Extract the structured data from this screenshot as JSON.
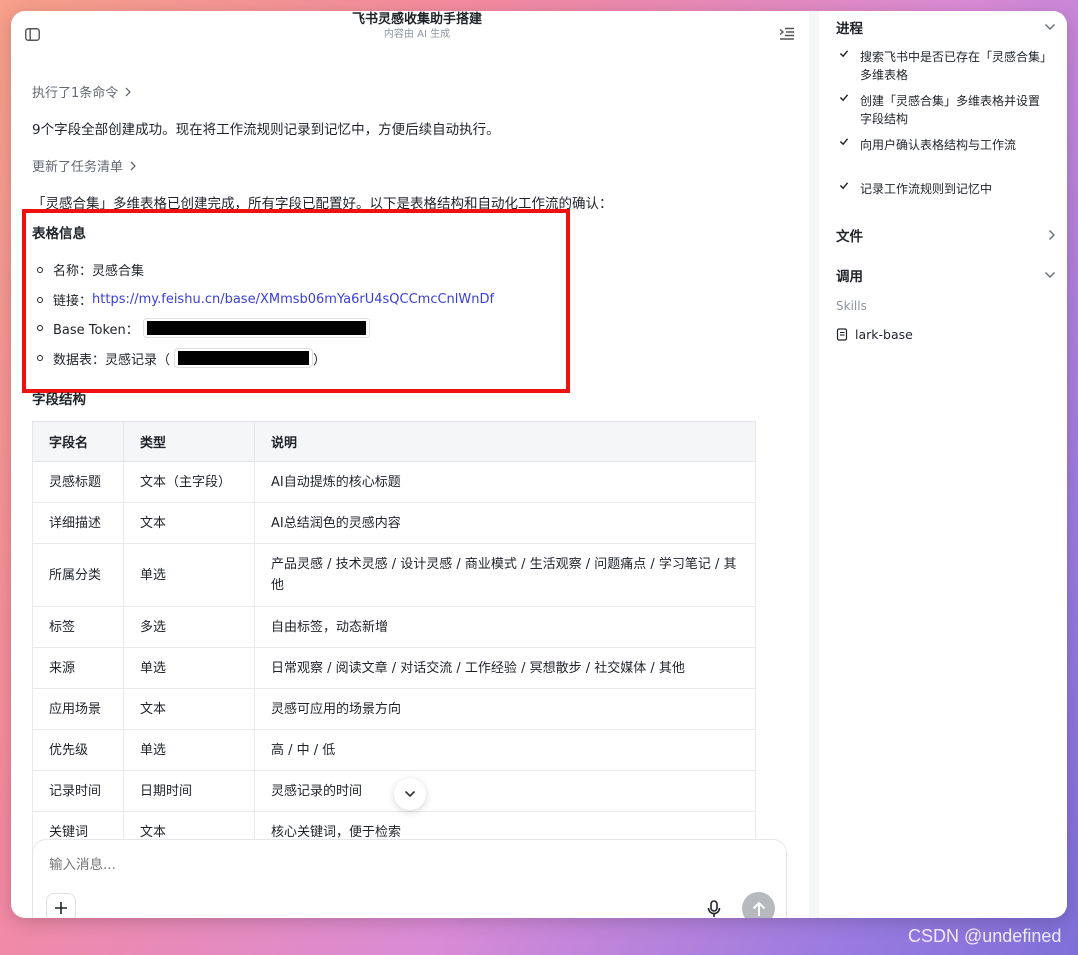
{
  "header": {
    "title": "飞书灵感收集助手搭建",
    "subtitle": "内容由 AI 生成"
  },
  "chat": {
    "step1": "执行了1条命令",
    "msg1": "9个字段全部创建成功。现在将工作流规则记录到记忆中，方便后续自动执行。",
    "step2": "更新了任务清单",
    "msg2": "「灵感合集」多维表格已创建完成，所有字段已配置好。以下是表格结构和自动化工作流的确认：",
    "table_info_heading": "表格信息",
    "info": {
      "name_label": "名称：",
      "name_value": "灵感合集",
      "link_label": "链接：",
      "link_value": "https://my.feishu.cn/base/XMmsb06mYa6rU4sQCCmcCnlWnDf",
      "token_label": "Base Token：",
      "datatable_label": "数据表：",
      "datatable_value": "灵感记录（",
      "datatable_close": "）"
    },
    "fields_heading": "字段结构"
  },
  "fields_table": {
    "headers": [
      "字段名",
      "类型",
      "说明"
    ],
    "rows": [
      [
        "灵感标题",
        "文本（主字段）",
        "AI自动提炼的核心标题"
      ],
      [
        "详细描述",
        "文本",
        "AI总结润色的灵感内容"
      ],
      [
        "所属分类",
        "单选",
        "产品灵感 / 技术灵感 / 设计灵感 / 商业模式 / 生活观察 / 问题痛点 / 学习笔记 / 其他"
      ],
      [
        "标签",
        "多选",
        "自由标签，动态新增"
      ],
      [
        "来源",
        "单选",
        "日常观察 / 阅读文章 / 对话交流 / 工作经验 / 冥想散步 / 社交媒体 / 其他"
      ],
      [
        "应用场景",
        "文本",
        "灵感可应用的场景方向"
      ],
      [
        "优先级",
        "单选",
        "高 / 中 / 低"
      ],
      [
        "记录时间",
        "日期时间",
        "灵感记录的时间"
      ],
      [
        "关键词",
        "文本",
        "核心关键词，便于检索"
      ]
    ]
  },
  "composer": {
    "placeholder": "输入消息..."
  },
  "sidebar": {
    "progress_title": "进程",
    "progress_items": [
      "搜索飞书中是否已存在「灵感合集」多维表格",
      "创建「灵感合集」多维表格并设置字段结构",
      "向用户确认表格结构与工作流",
      "记录工作流规则到记忆中"
    ],
    "files_title": "文件",
    "calls_title": "调用",
    "skills_label": "Skills",
    "skill_name": "lark-base"
  },
  "watermark": "CSDN @undefined"
}
